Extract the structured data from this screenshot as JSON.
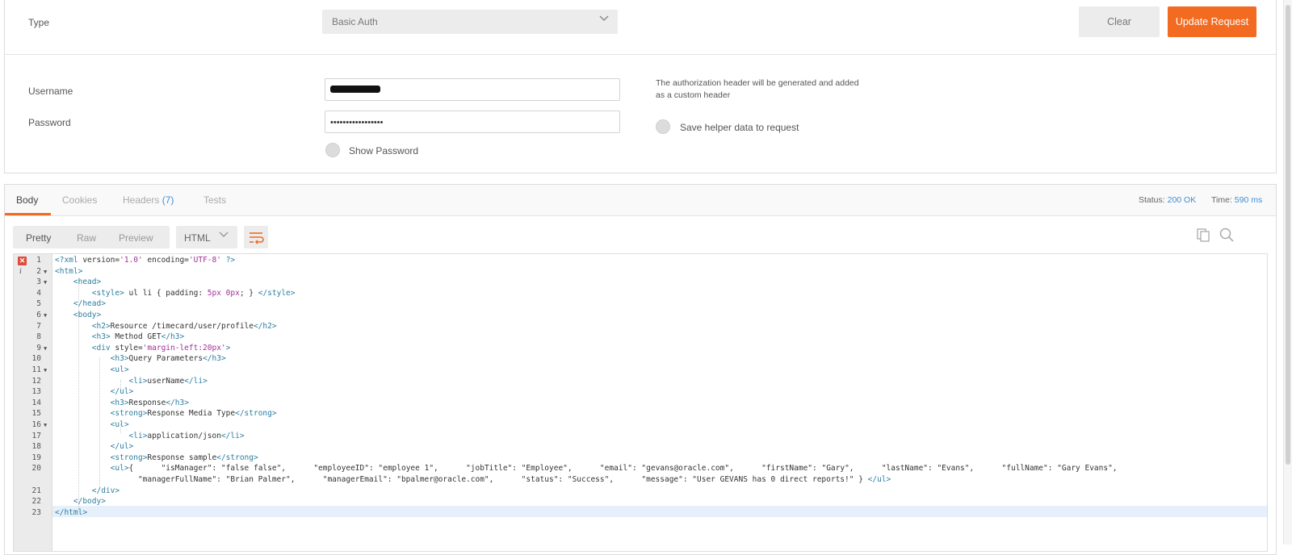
{
  "auth": {
    "type_label": "Type",
    "type_value": "Basic Auth",
    "clear_label": "Clear",
    "update_label": "Update Request",
    "username_label": "Username",
    "password_label": "Password",
    "password_value": "•••••••••••••••••",
    "show_password_label": "Show Password",
    "hint_text": "The authorization header will be generated and added as a custom header",
    "save_helper_label": "Save helper data to request"
  },
  "response": {
    "tabs": [
      {
        "label": "Body"
      },
      {
        "label": "Cookies"
      },
      {
        "label": "Headers",
        "count": "(7)"
      },
      {
        "label": "Tests"
      }
    ],
    "status_label": "Status:",
    "status_value": "200 OK",
    "time_label": "Time:",
    "time_value": "590 ms",
    "view_modes": [
      "Pretty",
      "Raw",
      "Preview"
    ],
    "format": "HTML"
  },
  "code": {
    "line_numbers": [
      "1",
      "2",
      "3",
      "4",
      "5",
      "6",
      "7",
      "8",
      "9",
      "10",
      "11",
      "12",
      "13",
      "14",
      "15",
      "16",
      "17",
      "18",
      "19",
      "20",
      "",
      "21",
      "22",
      "23"
    ],
    "lines": [
      "<?xml version='1.0' encoding='UTF-8' ?>",
      "<html>",
      "    <head>",
      "        <style> ul li { padding: 5px 0px; } </style>",
      "    </head>",
      "    <body>",
      "        <h2>Resource /timecard/user/profile</h2>",
      "        <h3> Method GET</h3>",
      "        <div style='margin-left:20px'>",
      "            <h3>Query Parameters</h3>",
      "            <ul>",
      "                <li>userName</li>",
      "            </ul>",
      "            <h3>Response</h3>",
      "            <strong>Response Media Type</strong>",
      "            <ul>",
      "                <li>application/json</li>",
      "            </ul>",
      "            <strong>Response sample</strong>",
      "            <ul>{      \"isManager\": \"false false\",      \"employeeID\": \"employee 1\",      \"jobTitle\": \"Employee\",      \"email\": \"gevans@oracle.com\",      \"firstName\": \"Gary\",      \"lastName\": \"Evans\",      \"fullName\": \"Gary Evans\",",
      "                  \"managerFullName\": \"Brian Palmer\",      \"managerEmail\": \"bpalmer@oracle.com\",      \"status\": \"Success\",      \"message\": \"User GEVANS has 0 direct reports!\" } </ul>",
      "        </div>",
      "    </body>",
      "</html>"
    ]
  },
  "colors": {
    "accent": "#f26b21",
    "link": "#3f8fd6"
  }
}
